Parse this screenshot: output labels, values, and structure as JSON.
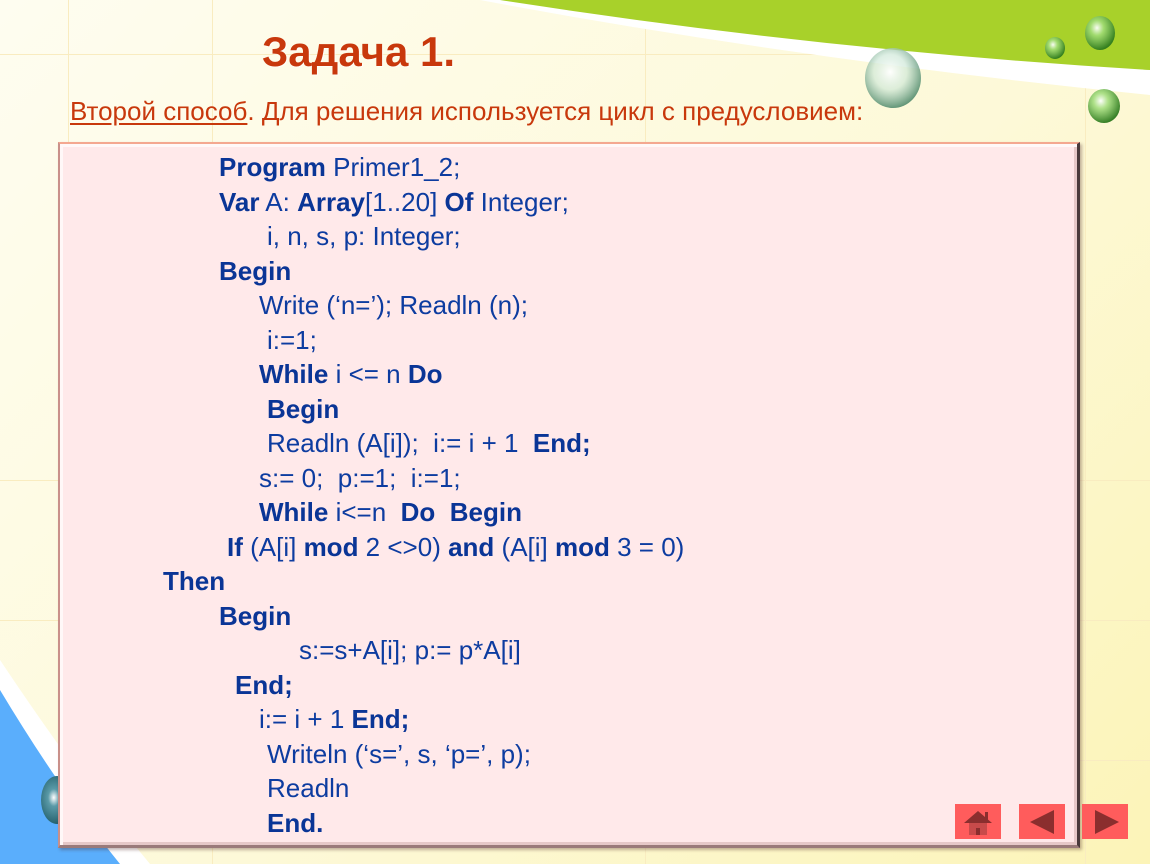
{
  "slide": {
    "title": "Задача 1.",
    "subtitle": {
      "link_text": "Второй способ",
      "rest_text": ". Для решения используется цикл с предусловием:"
    },
    "code_lines": [
      {
        "indent": 1,
        "segments": [
          {
            "t": "Program",
            "b": true
          },
          {
            "t": " Primer1_2;",
            "b": false
          }
        ]
      },
      {
        "indent": 1,
        "segments": [
          {
            "t": "Var",
            "b": true
          },
          {
            "t": " A: ",
            "b": false
          },
          {
            "t": "Array",
            "b": true
          },
          {
            "t": "[1..20] ",
            "b": false
          },
          {
            "t": "Of",
            "b": true
          },
          {
            "t": " Integer;",
            "b": false
          }
        ]
      },
      {
        "indent": 2,
        "segments": [
          {
            "t": "i, n, s, p: Integer;",
            "b": false
          }
        ]
      },
      {
        "indent": 1,
        "segments": [
          {
            "t": "Begin",
            "b": true
          }
        ]
      },
      {
        "indent": 3,
        "segments": [
          {
            "t": "Write (‘n=’); Readln (n);",
            "b": false
          }
        ]
      },
      {
        "indent": 4,
        "segments": [
          {
            "t": "i:=1;",
            "b": false
          }
        ]
      },
      {
        "indent": 3,
        "segments": [
          {
            "t": "While",
            "b": true
          },
          {
            "t": " i <= n ",
            "b": false
          },
          {
            "t": "Do",
            "b": true
          }
        ]
      },
      {
        "indent": 5,
        "segments": [
          {
            "t": "Begin",
            "b": true
          }
        ]
      },
      {
        "indent": 5,
        "segments": [
          {
            "t": "Readln (A[i]);  i:= i + 1  ",
            "b": false
          },
          {
            "t": "End;",
            "b": true
          }
        ]
      },
      {
        "indent": 3,
        "segments": [
          {
            "t": "s:= 0;  p:=1;  i:=1;",
            "b": false
          }
        ]
      },
      {
        "indent": 3,
        "segments": [
          {
            "t": "While",
            "b": true
          },
          {
            "t": " i<=n  ",
            "b": false
          },
          {
            "t": "Do  Begin",
            "b": true
          }
        ]
      },
      {
        "indent": 6,
        "segments": [
          {
            "t": "If",
            "b": true
          },
          {
            "t": " (A[i] ",
            "b": false
          },
          {
            "t": "mod",
            "b": true
          },
          {
            "t": " 2 <>0) ",
            "b": false
          },
          {
            "t": "and",
            "b": true
          },
          {
            "t": " (A[i] ",
            "b": false
          },
          {
            "t": "mod",
            "b": true
          },
          {
            "t": " 3 = 0)",
            "b": false
          }
        ]
      },
      {
        "indent": 0,
        "segments": [
          {
            "t": "Then",
            "b": true
          }
        ]
      },
      {
        "indent": 1,
        "segments": [
          {
            "t": "Begin",
            "b": true
          }
        ]
      },
      {
        "indent": 7,
        "segments": [
          {
            "t": "s:=s+A[i]; p:= p*A[i]",
            "b": false
          }
        ]
      },
      {
        "indent": 8,
        "segments": [
          {
            "t": "End;",
            "b": true
          }
        ]
      },
      {
        "indent": 3,
        "segments": [
          {
            "t": "i:= i + 1 ",
            "b": false
          },
          {
            "t": "End;",
            "b": true
          }
        ]
      },
      {
        "indent": 5,
        "segments": [
          {
            "t": "Writeln (‘s=’, s, ‘p=’, p);",
            "b": false
          }
        ]
      },
      {
        "indent": 5,
        "segments": [
          {
            "t": "Readln",
            "b": false
          }
        ]
      },
      {
        "indent": 5,
        "segments": [
          {
            "t": "End.",
            "b": true
          }
        ]
      }
    ]
  },
  "navigation": {
    "buttons": [
      {
        "name": "home-button",
        "icon": "home-icon"
      },
      {
        "name": "previous-button",
        "icon": "triangle-left-icon"
      },
      {
        "name": "next-button",
        "icon": "triangle-right-icon"
      }
    ]
  },
  "colors": {
    "title": "#c8380c",
    "code_text": "#0d3ca0",
    "code_bg": "#ffe9ea",
    "nav_button": "#ff5c5c",
    "nav_icon": "#8b2e2e",
    "green_band": "#a8d12a",
    "blue_band": "#5aaefc"
  }
}
